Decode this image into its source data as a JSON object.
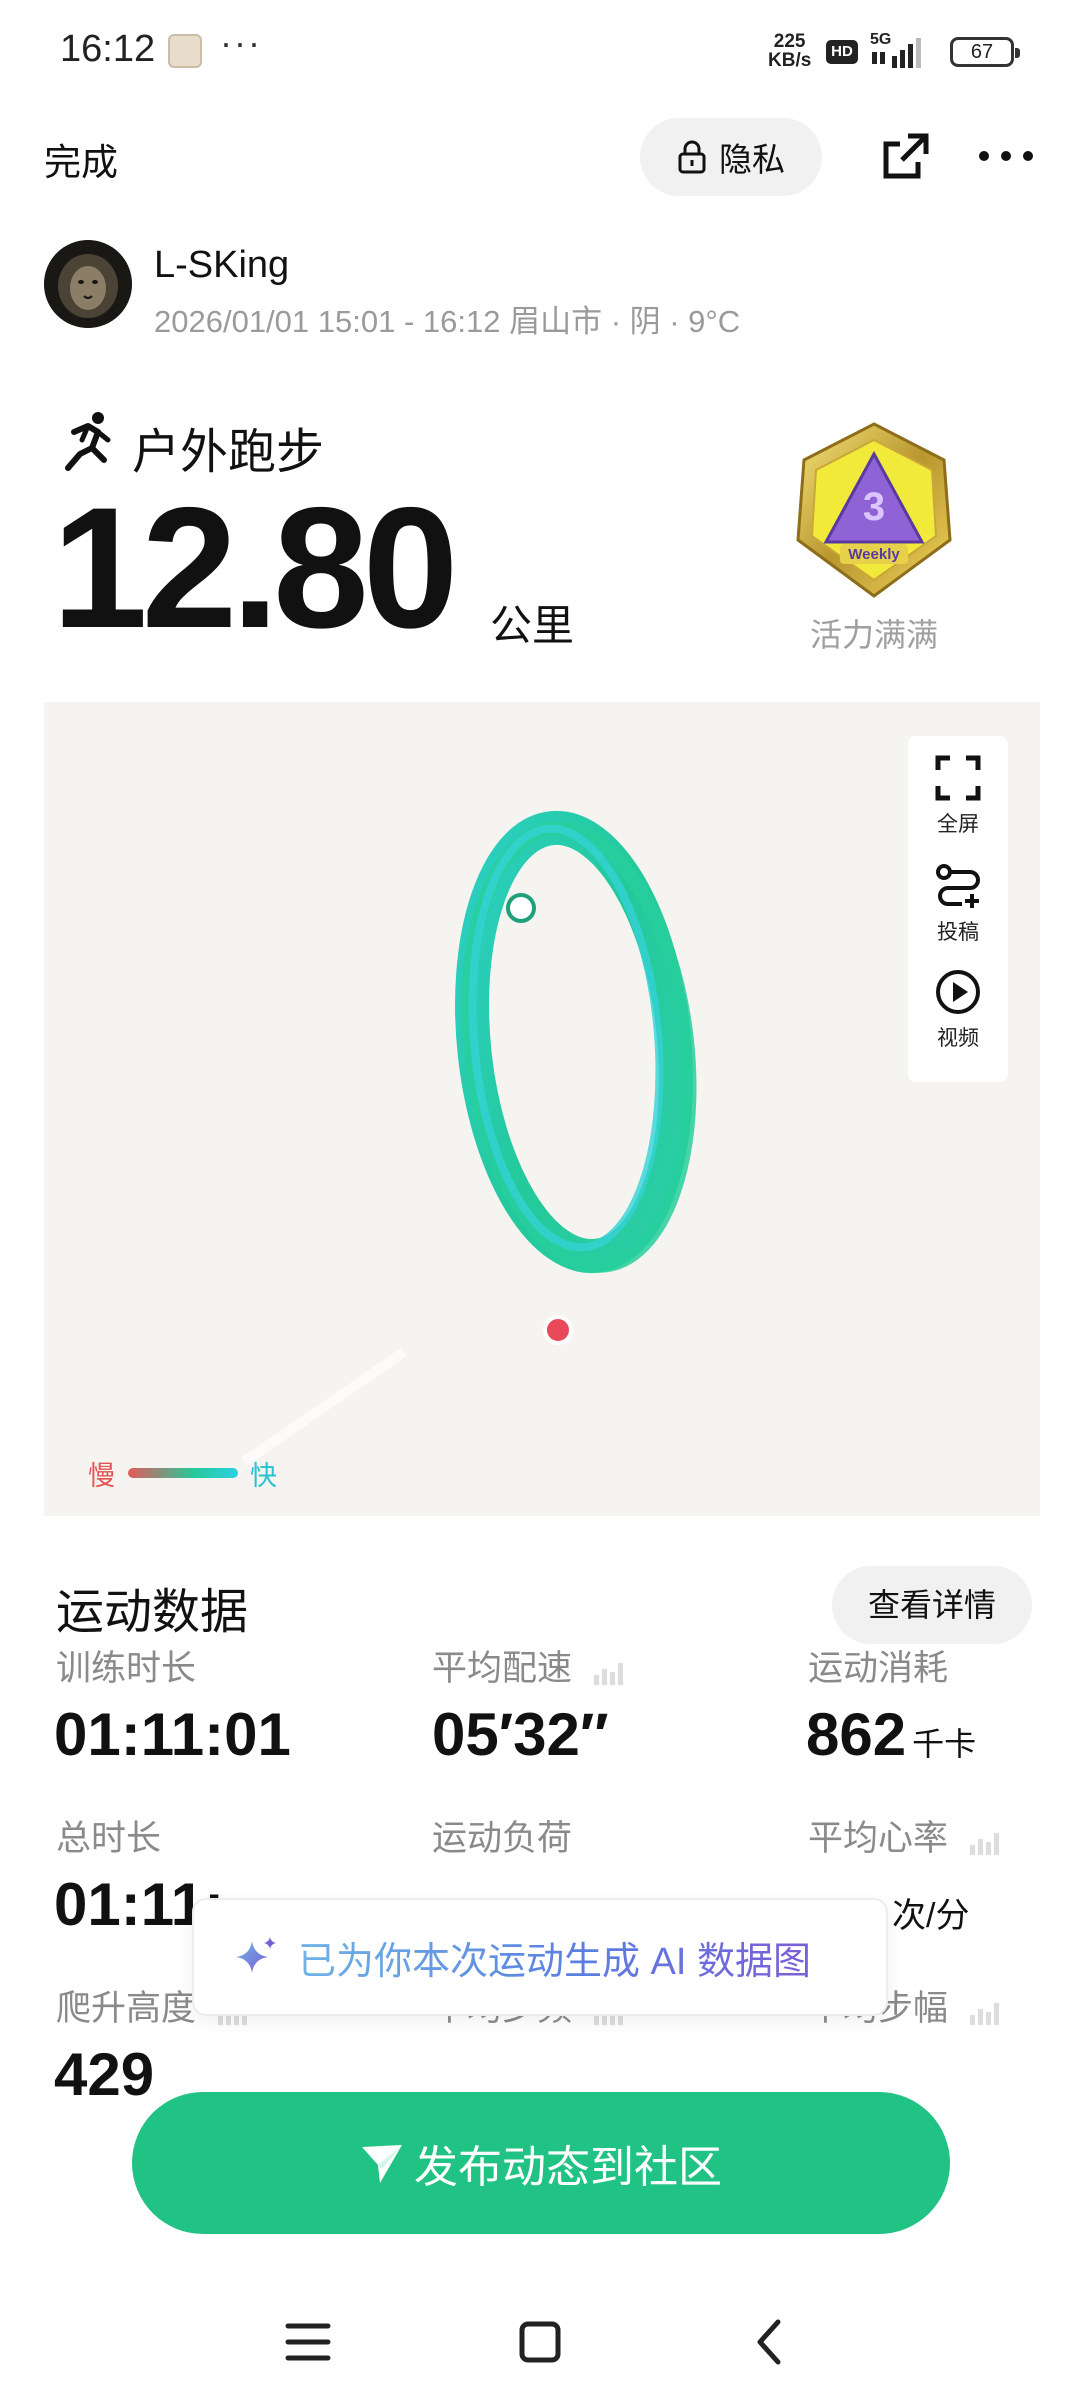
{
  "status_bar": {
    "time": "16:12",
    "dots": "···",
    "net_speed": "225",
    "net_unit": "KB/s",
    "hd": "HD",
    "network": "5G",
    "battery": "67"
  },
  "header": {
    "done_label": "完成",
    "privacy_label": "隐私",
    "icons": [
      "lock-icon",
      "share-icon",
      "more-icon"
    ]
  },
  "user": {
    "name": "L-SKing",
    "meta": "2026/01/01 15:01 - 16:12 眉山市 · 阴 · 9°C"
  },
  "workout": {
    "sport": "户外跑步",
    "distance": "12.80",
    "unit": "公里",
    "badge_label": "活力满满",
    "badge_text": "Weekly"
  },
  "map": {
    "tools": [
      {
        "label": "全屏",
        "icon": "fullscreen-icon"
      },
      {
        "label": "投稿",
        "icon": "submit-route-icon"
      },
      {
        "label": "视频",
        "icon": "play-video-icon"
      }
    ],
    "legend_slow": "慢",
    "legend_fast": "快",
    "colors": {
      "slow": "#e35b5b",
      "mid": "#26c99a",
      "fast": "#2ed1e1",
      "start": "#ffffff",
      "end": "#e84a5a"
    }
  },
  "stats_section": {
    "title": "运动数据",
    "detail_button": "查看详情",
    "items": [
      {
        "label": "训练时长",
        "value": "01:11:01",
        "unit": ""
      },
      {
        "label": "平均配速",
        "value": "05′32″",
        "unit": ""
      },
      {
        "label": "运动消耗",
        "value": "862",
        "unit": "千卡"
      },
      {
        "label": "总时长",
        "value": "01:11:",
        "unit": ""
      },
      {
        "label": "运动负荷",
        "value": "",
        "unit": ""
      },
      {
        "label": "平均心率",
        "value": "",
        "unit": "次/分"
      },
      {
        "label": "爬升高度",
        "value": "429",
        "unit": ""
      },
      {
        "label": "平均步频",
        "value": "",
        "unit": ""
      },
      {
        "label": "平均步幅",
        "value": "",
        "unit": ""
      }
    ]
  },
  "ai_banner": {
    "text": "已为你本次运动生成 AI 数据图"
  },
  "publish": {
    "label": "发布动态到社区"
  },
  "accent": "#21c384"
}
